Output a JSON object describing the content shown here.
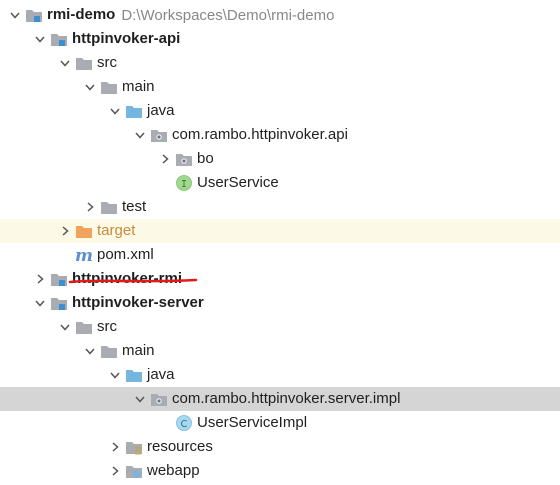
{
  "tree": [
    {
      "depth": 0,
      "arrow": "down",
      "icon": "module-folder-icon",
      "label": "rmi-demo",
      "bold": true,
      "path": "D:\\Workspaces\\Demo\\rmi-demo"
    },
    {
      "depth": 1,
      "arrow": "down",
      "icon": "module-folder-icon",
      "label": "httpinvoker-api",
      "bold": true
    },
    {
      "depth": 2,
      "arrow": "down",
      "icon": "folder-icon",
      "label": "src"
    },
    {
      "depth": 3,
      "arrow": "down",
      "icon": "folder-icon",
      "label": "main"
    },
    {
      "depth": 4,
      "arrow": "down",
      "icon": "source-folder-icon",
      "label": "java"
    },
    {
      "depth": 5,
      "arrow": "down",
      "icon": "package-icon",
      "label": "com.rambo.httpinvoker.api"
    },
    {
      "depth": 6,
      "arrow": "right",
      "icon": "package-icon",
      "label": "bo"
    },
    {
      "depth": 6,
      "arrow": "none",
      "icon": "interface-icon",
      "label": "UserService"
    },
    {
      "depth": 3,
      "arrow": "right",
      "icon": "folder-icon",
      "label": "test"
    },
    {
      "depth": 2,
      "arrow": "right",
      "icon": "excluded-folder-icon",
      "label": "target",
      "highlight": "target"
    },
    {
      "depth": 2,
      "arrow": "none",
      "icon": "maven-icon",
      "label": "pom.xml"
    },
    {
      "depth": 1,
      "arrow": "right",
      "icon": "module-folder-icon",
      "label": "httpinvoker-rmi",
      "bold": true,
      "struck": true
    },
    {
      "depth": 1,
      "arrow": "down",
      "icon": "module-folder-icon",
      "label": "httpinvoker-server",
      "bold": true
    },
    {
      "depth": 2,
      "arrow": "down",
      "icon": "folder-icon",
      "label": "src"
    },
    {
      "depth": 3,
      "arrow": "down",
      "icon": "folder-icon",
      "label": "main"
    },
    {
      "depth": 4,
      "arrow": "down",
      "icon": "source-folder-icon",
      "label": "java"
    },
    {
      "depth": 5,
      "arrow": "down",
      "icon": "package-icon",
      "label": "com.rambo.httpinvoker.server.impl",
      "highlight": "select"
    },
    {
      "depth": 6,
      "arrow": "none",
      "icon": "class-icon",
      "label": "UserServiceImpl"
    },
    {
      "depth": 4,
      "arrow": "right",
      "icon": "resources-folder-icon",
      "label": "resources"
    },
    {
      "depth": 4,
      "arrow": "right",
      "icon": "web-folder-icon",
      "label": "webapp"
    }
  ],
  "colors": {
    "folder": "#a9adb3",
    "source_folder": "#74b6e0",
    "module_badge": "#3e8fd0",
    "excluded_folder": "#f0a35a",
    "interface_fill": "#9fd98f",
    "interface_letter": "#3b7a2f",
    "class_fill": "#a7d8ef",
    "class_letter": "#2b6f94",
    "maven": "#5a8fd0",
    "strike": "#e01b1b",
    "selection": "#d5d5d5",
    "target_row": "#fcfae6"
  }
}
